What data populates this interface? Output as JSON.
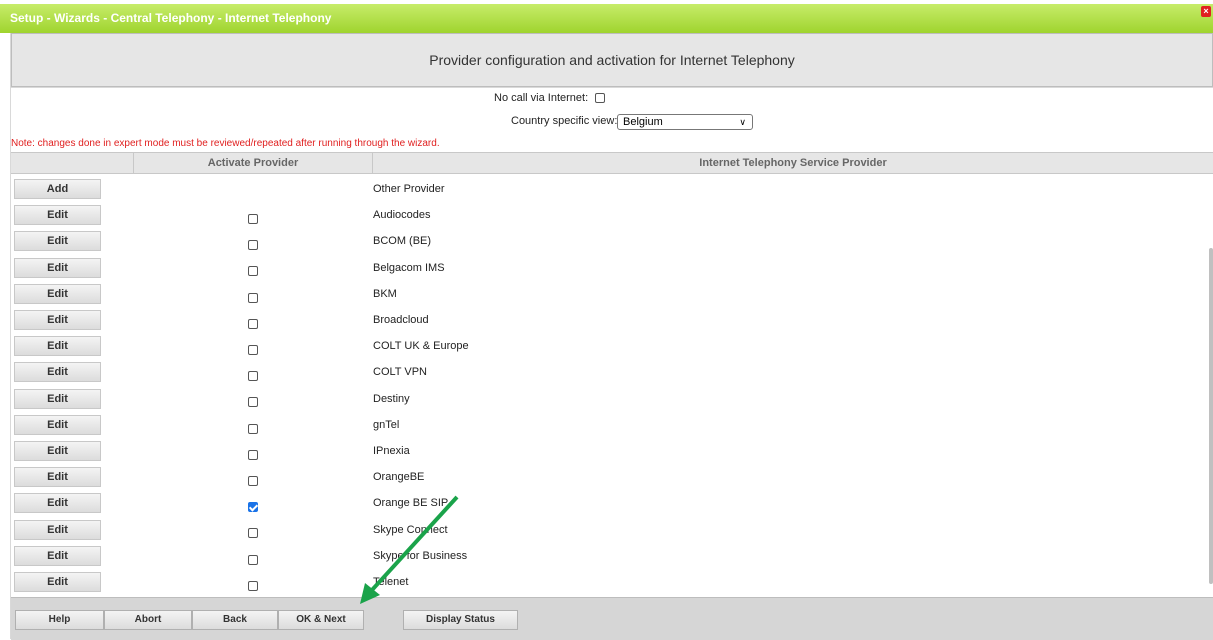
{
  "window": {
    "title": "Setup - Wizards - Central Telephony - Internet Telephony",
    "close_icon": "×"
  },
  "header": {
    "heading": "Provider configuration and activation for Internet Telephony"
  },
  "form": {
    "no_call_label": "No call via Internet:",
    "no_call_checked": false,
    "country_label": "Country specific view:",
    "country_value": "Belgium",
    "note": "Note: changes done in expert mode must be reviewed/repeated after running through the wizard."
  },
  "table": {
    "col_activate": "Activate Provider",
    "col_provider": "Internet Telephony Service Provider",
    "rows": [
      {
        "button": "Add",
        "provider": "Other Provider",
        "has_checkbox": false,
        "checked": false
      },
      {
        "button": "Edit",
        "provider": "Audiocodes",
        "has_checkbox": true,
        "checked": false
      },
      {
        "button": "Edit",
        "provider": "BCOM (BE)",
        "has_checkbox": true,
        "checked": false
      },
      {
        "button": "Edit",
        "provider": "Belgacom IMS",
        "has_checkbox": true,
        "checked": false
      },
      {
        "button": "Edit",
        "provider": "BKM",
        "has_checkbox": true,
        "checked": false
      },
      {
        "button": "Edit",
        "provider": "Broadcloud",
        "has_checkbox": true,
        "checked": false
      },
      {
        "button": "Edit",
        "provider": "COLT UK & Europe",
        "has_checkbox": true,
        "checked": false
      },
      {
        "button": "Edit",
        "provider": "COLT VPN",
        "has_checkbox": true,
        "checked": false
      },
      {
        "button": "Edit",
        "provider": "Destiny",
        "has_checkbox": true,
        "checked": false
      },
      {
        "button": "Edit",
        "provider": "gnTel",
        "has_checkbox": true,
        "checked": false
      },
      {
        "button": "Edit",
        "provider": "IPnexia",
        "has_checkbox": true,
        "checked": false
      },
      {
        "button": "Edit",
        "provider": "OrangeBE",
        "has_checkbox": true,
        "checked": false
      },
      {
        "button": "Edit",
        "provider": "Orange BE SIP",
        "has_checkbox": true,
        "checked": true
      },
      {
        "button": "Edit",
        "provider": "Skype Connect",
        "has_checkbox": true,
        "checked": false
      },
      {
        "button": "Edit",
        "provider": "Skype for Business",
        "has_checkbox": true,
        "checked": false
      },
      {
        "button": "Edit",
        "provider": "Telenet",
        "has_checkbox": true,
        "checked": false
      }
    ]
  },
  "footer": {
    "help": "Help",
    "abort": "Abort",
    "back": "Back",
    "ok_next": "OK & Next",
    "display_status": "Display Status"
  },
  "colors": {
    "titlebar": "#9fd42e",
    "note": "#e02020",
    "annotation_arrow": "#1aa34a",
    "checkbox_checked": "#1a73e8"
  }
}
